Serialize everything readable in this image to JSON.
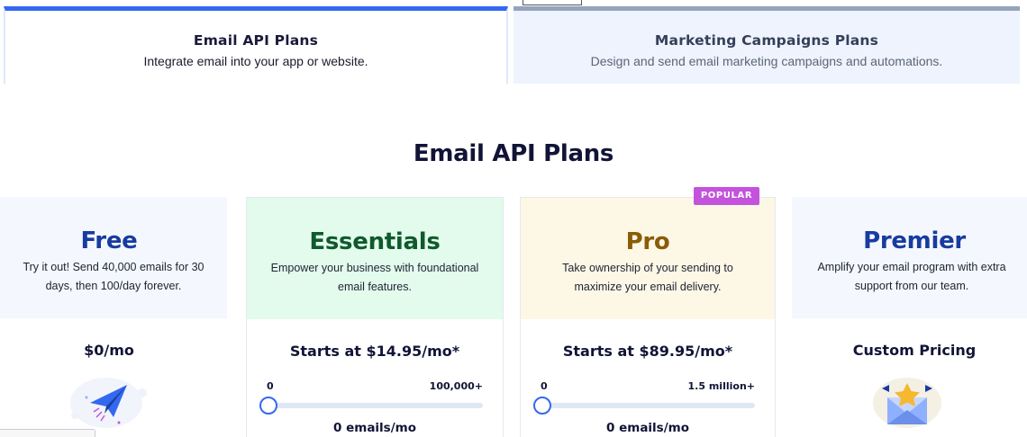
{
  "tabs": [
    {
      "title": "Email API Plans",
      "subtitle": "Integrate email into your app or website."
    },
    {
      "title": "Marketing Campaigns Plans",
      "subtitle": "Design and send email marketing campaigns and automations."
    }
  ],
  "section_title": "Email API Plans",
  "plans": [
    {
      "name": "Free",
      "description": "Try it out! Send 40,000 emails for 30 days, then 100/day forever.",
      "price": "$0/mo",
      "illustration": "paper-plane-icon"
    },
    {
      "name": "Essentials",
      "description": "Empower your business with foundational email features.",
      "price": "Starts at $14.95/mo*",
      "slider_min": "0",
      "slider_max": "100,000+",
      "slider_fraction": 0,
      "volume": "0 emails/mo"
    },
    {
      "name": "Pro",
      "badge": "POPULAR",
      "description": "Take ownership of your sending to maximize your email delivery.",
      "price": "Starts at $89.95/mo*",
      "slider_min": "0",
      "slider_max": "1.5 million+",
      "slider_fraction": 0,
      "volume": "0 emails/mo"
    },
    {
      "name": "Premier",
      "description": "Amplify your email program with extra support from our team.",
      "price": "Custom Pricing",
      "illustration": "envelope-star-icon"
    }
  ],
  "colors": {
    "accent": "#3368f0",
    "badge": "#c352dc",
    "free": "#173ba0",
    "essentials": "#0f5a2d",
    "pro": "#8a5c06",
    "premier": "#173ba0"
  }
}
